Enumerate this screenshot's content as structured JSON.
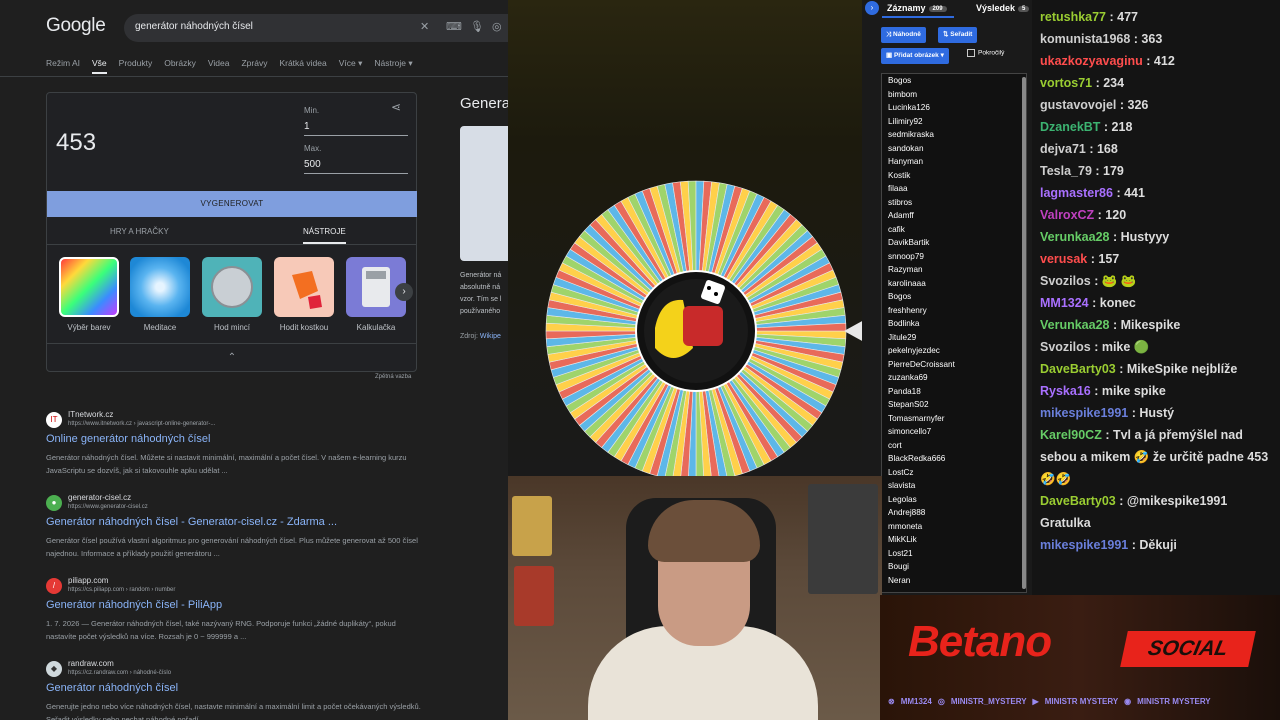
{
  "google": {
    "logo": "Google",
    "query": "generátor náhodných čísel",
    "tabs": [
      "Režim AI",
      "Vše",
      "Produkty",
      "Obrázky",
      "Videa",
      "Zprávy",
      "Krátká videa",
      "Více ▾",
      "Nástroje ▾"
    ],
    "active_tab": "Vše",
    "widget": {
      "result": "453",
      "min_label": "Min.",
      "min_value": "1",
      "max_label": "Max.",
      "max_value": "500",
      "generate_label": "VYGENEROVAT",
      "subtab_games": "HRY A HRAČKY",
      "subtab_tools": "NÁSTROJE",
      "tools": [
        "Výběr barev",
        "Meditace",
        "Hod mincí",
        "Hodit kostkou",
        "Kalkulačka"
      ],
      "feedback": "Zpětná vazba"
    },
    "knowledge_panel": {
      "title": "Genera",
      "text": "Generátor ná absolutně ná vzor. Tím se l používaného",
      "source_label": "Zdroj:",
      "source_link": "Wikipe"
    },
    "results": [
      {
        "site": "ITnetwork.cz",
        "url": "https://www.itnetwork.cz › javascript-online-generator-...",
        "title": "Online generátor náhodných čísel",
        "snippet": "Generátor náhodných čísel. Můžete si nastavit minimální, maximální a počet čísel. V našem e-learning kurzu JavaScriptu se dozvíš, jak si takovouhle apku udělat ..."
      },
      {
        "site": "generator-cisel.cz",
        "url": "https://www.generator-cisel.cz",
        "title": "Generátor náhodných čísel - Generator-cisel.cz - Zdarma ...",
        "snippet": "Generátor čísel používá vlastní algoritmus pro generování náhodných čísel. Plus můžete generovat až 500 čísel najednou. Informace a příklady použití generátoru ..."
      },
      {
        "site": "piliapp.com",
        "url": "https://cs.piliapp.com › random › number",
        "title": "Generátor náhodných čísel - PiliApp",
        "snippet": "1. 7. 2026 — Generátor náhodných čísel, také nazývaný RNG. Podporuje funkci „žádné duplikáty“, pokud nastavíte počet výsledků na více. Rozsah je 0 ~ 999999 a ..."
      },
      {
        "site": "randraw.com",
        "url": "https://cz.randraw.com › náhodné-číslo",
        "title": "Generátor náhodných čísel",
        "snippet": "Generujte jedno nebo více náhodných čísel, nastavte minimální a maximální limit a počet očekávaných výsledků. Seřadit výsledky nebo nechat náhodné pořadí."
      }
    ]
  },
  "entries": {
    "tab_entries": "Záznamy",
    "entries_count": "209",
    "tab_results": "Výsledek",
    "results_count": "5",
    "shuffle_label": "Náhodně",
    "sort_label": "Seřadit",
    "add_image_label": "Přidat obrázek",
    "advanced_label": "Pokročilý",
    "names": [
      "Bogos",
      "bimbom",
      "Lucinka126",
      "Lilimiry92",
      "sedmikraska",
      "sandokan",
      "Hanyman",
      "Kostik",
      "filaaa",
      "stibros",
      "Adamff",
      "cafik",
      "DavikBartik",
      "snnoop79",
      "Razyman",
      "karolinaaa",
      "Bogos",
      "freshhenry",
      "Bodlinka",
      "Jitule29",
      "pekelnyjezdec",
      "PierreDeCroissant",
      "zuzanka69",
      "Panda18",
      "StepanS02",
      "Tomasmarnyfer",
      "simoncello7",
      "cort",
      "BlackRedka666",
      "LostCz",
      "slavista",
      "Legolas",
      "Andrej888",
      "mmoneta",
      "MikKLik",
      "Lost21",
      "Bougi",
      "Neran"
    ]
  },
  "chat": [
    {
      "user": "retushka77",
      "color": "#9acd32",
      "text": " : 477"
    },
    {
      "user": "komunista1968",
      "color": "#cfcfcf",
      "text": " : 363"
    },
    {
      "user": "ukazkozyavaginu",
      "color": "#ff4d4d",
      "text": " : 412"
    },
    {
      "user": "vortos71",
      "color": "#9acd32",
      "text": " : 234"
    },
    {
      "user": "gustavovojel",
      "color": "#cfcfcf",
      "text": " : 326"
    },
    {
      "user": "DzanekBT",
      "color": "#3cb371",
      "text": " : 218"
    },
    {
      "user": "dejva71",
      "color": "#cfcfcf",
      "text": " : 168"
    },
    {
      "user": "Tesla_79",
      "color": "#cfcfcf",
      "text": " : 179"
    },
    {
      "user": "lagmaster86",
      "color": "#a970ff",
      "text": " : 441"
    },
    {
      "user": "ValroxCZ",
      "color": "#c040c0",
      "text": " : 120"
    },
    {
      "user": "Verunkaa28",
      "color": "#66cc66",
      "text": " : Hustyyy"
    },
    {
      "user": "verusak",
      "color": "#ff4d4d",
      "text": " : 157"
    },
    {
      "user": "Svozilos",
      "color": "#cfcfcf",
      "text": " : 🐸 🐸"
    },
    {
      "user": "MM1324",
      "color": "#a970ff",
      "text": " : konec"
    },
    {
      "user": "Verunkaa28",
      "color": "#66cc66",
      "text": " : Mikespike"
    },
    {
      "user": "Svozilos",
      "color": "#cfcfcf",
      "text": " : mike 🟢"
    },
    {
      "user": "DaveBarty03",
      "color": "#9acd32",
      "text": " : MikeSpike nejblíže"
    },
    {
      "user": "Ryska16",
      "color": "#a970ff",
      "text": " : mike spike"
    },
    {
      "user": "mikespike1991",
      "color": "#6a7fdb",
      "text": " : Hustý"
    },
    {
      "user": "Karel90CZ",
      "color": "#66cc66",
      "text": " : Tvl a já přemýšlel nad sebou a mikem 🤣 že určitě padne 453 🤣🤣"
    },
    {
      "user": "DaveBarty03",
      "color": "#9acd32",
      "text": " : @mikespike1991 Gratulka"
    },
    {
      "user": "mikespike1991",
      "color": "#6a7fdb",
      "text": " : Děkuji"
    }
  ],
  "betano": {
    "logo": "Betano",
    "social": "SOCIAL",
    "socials": [
      "MM1324",
      "MINISTR_MYSTERY",
      "MINISTR MYSTERY",
      "MINISTR MYSTERY"
    ]
  },
  "colors": {
    "google_bg": "#1f1f1f",
    "link": "#8ab4f8",
    "accent_blue": "#2f6be0",
    "betano_red": "#e8231b"
  }
}
